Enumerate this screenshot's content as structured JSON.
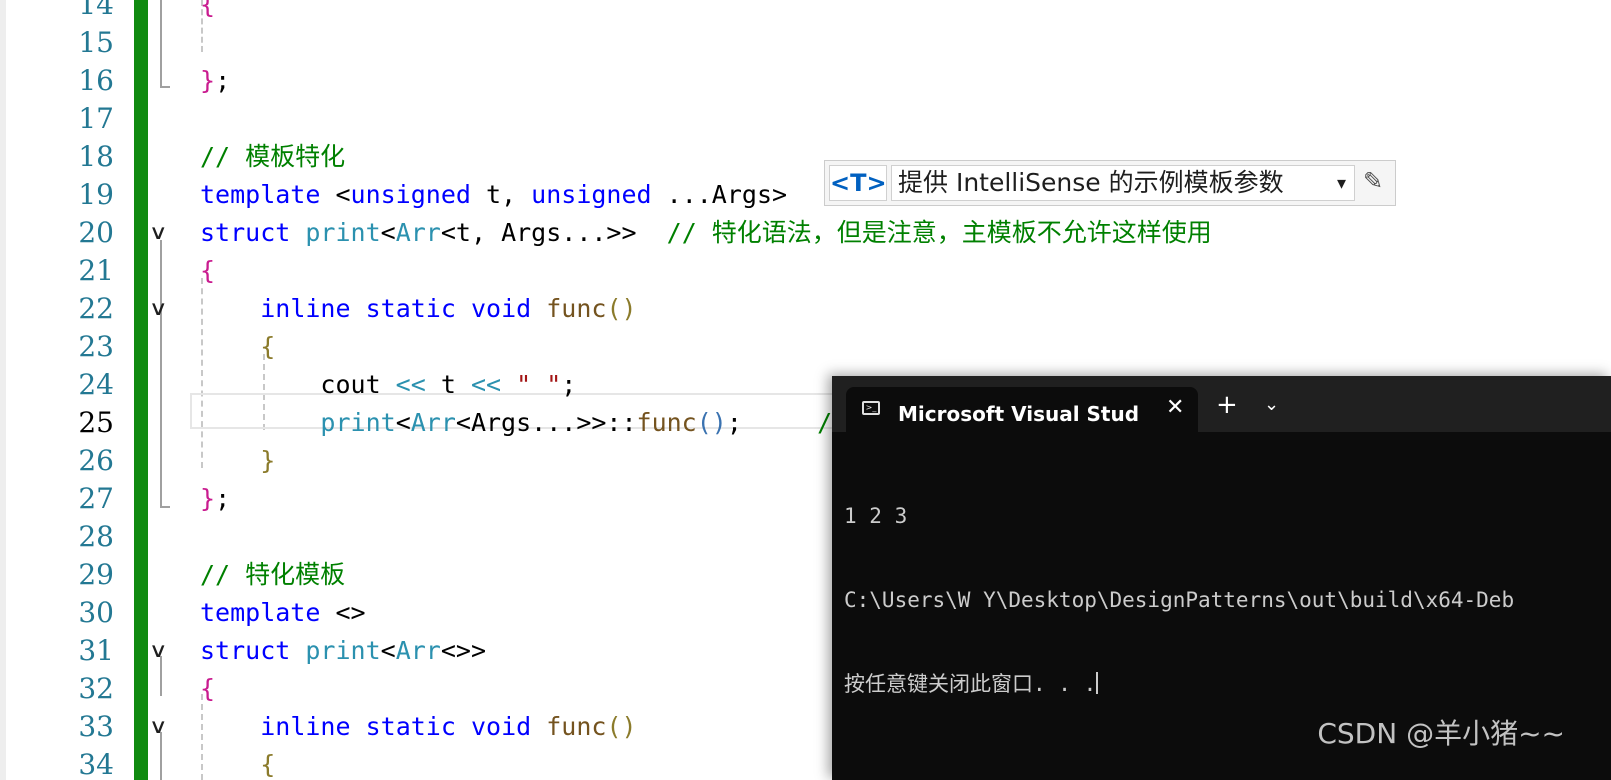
{
  "editor": {
    "lines": [
      {
        "n": "14",
        "code": [
          {
            "t": "{",
            "c": "brace1"
          }
        ]
      },
      {
        "n": "15",
        "code": []
      },
      {
        "n": "16",
        "code": [
          {
            "t": "}",
            "c": "brace1"
          },
          {
            "t": ";",
            "c": ""
          }
        ]
      },
      {
        "n": "17",
        "code": []
      },
      {
        "n": "18",
        "code": [
          {
            "t": "// 模板特化",
            "c": "c"
          }
        ]
      },
      {
        "n": "19",
        "code": [
          {
            "t": "template",
            "c": "k"
          },
          {
            "t": " <",
            "c": ""
          },
          {
            "t": "unsigned",
            "c": "k"
          },
          {
            "t": " t, ",
            "c": ""
          },
          {
            "t": "unsigned",
            "c": "k"
          },
          {
            "t": " ...Args>",
            "c": ""
          }
        ]
      },
      {
        "n": "20",
        "code": [
          {
            "t": "struct",
            "c": "k"
          },
          {
            "t": " ",
            "c": ""
          },
          {
            "t": "print",
            "c": "t"
          },
          {
            "t": "<",
            "c": ""
          },
          {
            "t": "Arr",
            "c": "t"
          },
          {
            "t": "<t, Args...>>  ",
            "c": ""
          },
          {
            "t": "// 特化语法，但是注意，主模板不允许这样使用",
            "c": "c"
          }
        ]
      },
      {
        "n": "21",
        "code": [
          {
            "t": "{",
            "c": "brace1"
          }
        ]
      },
      {
        "n": "22",
        "code": [
          {
            "t": "    ",
            "c": ""
          },
          {
            "t": "inline",
            "c": "k"
          },
          {
            "t": " ",
            "c": ""
          },
          {
            "t": "static",
            "c": "k"
          },
          {
            "t": " ",
            "c": ""
          },
          {
            "t": "void",
            "c": "k"
          },
          {
            "t": " ",
            "c": ""
          },
          {
            "t": "func",
            "c": "f"
          },
          {
            "t": "()",
            "c": "brace2"
          }
        ]
      },
      {
        "n": "23",
        "code": [
          {
            "t": "    ",
            "c": ""
          },
          {
            "t": "{",
            "c": "brace2"
          }
        ]
      },
      {
        "n": "24",
        "code": [
          {
            "t": "        cout ",
            "c": ""
          },
          {
            "t": "<<",
            "c": "t"
          },
          {
            "t": " t ",
            "c": ""
          },
          {
            "t": "<<",
            "c": "t"
          },
          {
            "t": " ",
            "c": ""
          },
          {
            "t": "\" \"",
            "c": "s"
          },
          {
            "t": ";",
            "c": ""
          }
        ]
      },
      {
        "n": "25",
        "code": [
          {
            "t": "        ",
            "c": ""
          },
          {
            "t": "print",
            "c": "t"
          },
          {
            "t": "<",
            "c": ""
          },
          {
            "t": "Arr",
            "c": "t"
          },
          {
            "t": "<Args...>>::",
            "c": ""
          },
          {
            "t": "func",
            "c": "f"
          },
          {
            "t": "()",
            "c": "paren"
          },
          {
            "t": ";     ",
            "c": ""
          },
          {
            "t": "/",
            "c": "c"
          }
        ]
      },
      {
        "n": "26",
        "code": [
          {
            "t": "    ",
            "c": ""
          },
          {
            "t": "}",
            "c": "brace2"
          }
        ]
      },
      {
        "n": "27",
        "code": [
          {
            "t": "}",
            "c": "brace1"
          },
          {
            "t": ";",
            "c": ""
          }
        ]
      },
      {
        "n": "28",
        "code": []
      },
      {
        "n": "29",
        "code": [
          {
            "t": "// 特化模板",
            "c": "c"
          }
        ]
      },
      {
        "n": "30",
        "code": [
          {
            "t": "template",
            "c": "k"
          },
          {
            "t": " <>",
            "c": ""
          }
        ]
      },
      {
        "n": "31",
        "code": [
          {
            "t": "struct",
            "c": "k"
          },
          {
            "t": " ",
            "c": ""
          },
          {
            "t": "print",
            "c": "t"
          },
          {
            "t": "<",
            "c": ""
          },
          {
            "t": "Arr",
            "c": "t"
          },
          {
            "t": "<>>",
            "c": ""
          }
        ]
      },
      {
        "n": "32",
        "code": [
          {
            "t": "{",
            "c": "brace1"
          }
        ]
      },
      {
        "n": "33",
        "code": [
          {
            "t": "    ",
            "c": ""
          },
          {
            "t": "inline",
            "c": "k"
          },
          {
            "t": " ",
            "c": ""
          },
          {
            "t": "static",
            "c": "k"
          },
          {
            "t": " ",
            "c": ""
          },
          {
            "t": "void",
            "c": "k"
          },
          {
            "t": " ",
            "c": ""
          },
          {
            "t": "func",
            "c": "f"
          },
          {
            "t": "()",
            "c": "brace2"
          }
        ]
      },
      {
        "n": "34",
        "code": [
          {
            "t": "    ",
            "c": ""
          },
          {
            "t": "{",
            "c": "brace2"
          }
        ]
      }
    ],
    "current_line": "25",
    "fold_lines": [
      "20",
      "22",
      "31",
      "33"
    ],
    "colors": {
      "keyword": "#0000ff",
      "type": "#2b91af",
      "function": "#74531f",
      "comment": "#008000",
      "string": "#a31515",
      "change_bar": "#108a10"
    }
  },
  "intellisense": {
    "tag": "<T>",
    "text": "提供 IntelliSense 的示例模板参数",
    "dropdown_icon": "caret-down-icon",
    "edit_icon": "pencil-icon"
  },
  "terminal": {
    "tab_title": "Microsoft Visual Studio 调试控制台",
    "close_label": "✕",
    "new_tab_label": "+",
    "menu_label": "⌄",
    "output": [
      "1 2 3",
      "C:\\Users\\W Y\\Desktop\\DesignPatterns\\out\\build\\x64-Deb",
      "按任意键关闭此窗口. . ."
    ]
  },
  "watermark": "CSDN @羊小猪~~"
}
